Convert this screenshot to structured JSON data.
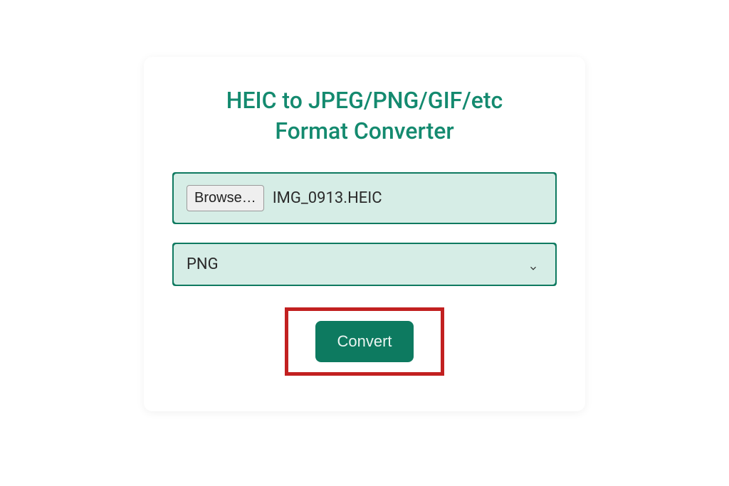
{
  "title": "HEIC to JPEG/PNG/GIF/etc\nFormat Converter",
  "file_input": {
    "browse_label": "Browse…",
    "selected_file": "IMG_0913.HEIC"
  },
  "format_select": {
    "selected": "PNG"
  },
  "convert_button_label": "Convert",
  "colors": {
    "accent": "#0d7a60",
    "highlight": "#c22020"
  }
}
